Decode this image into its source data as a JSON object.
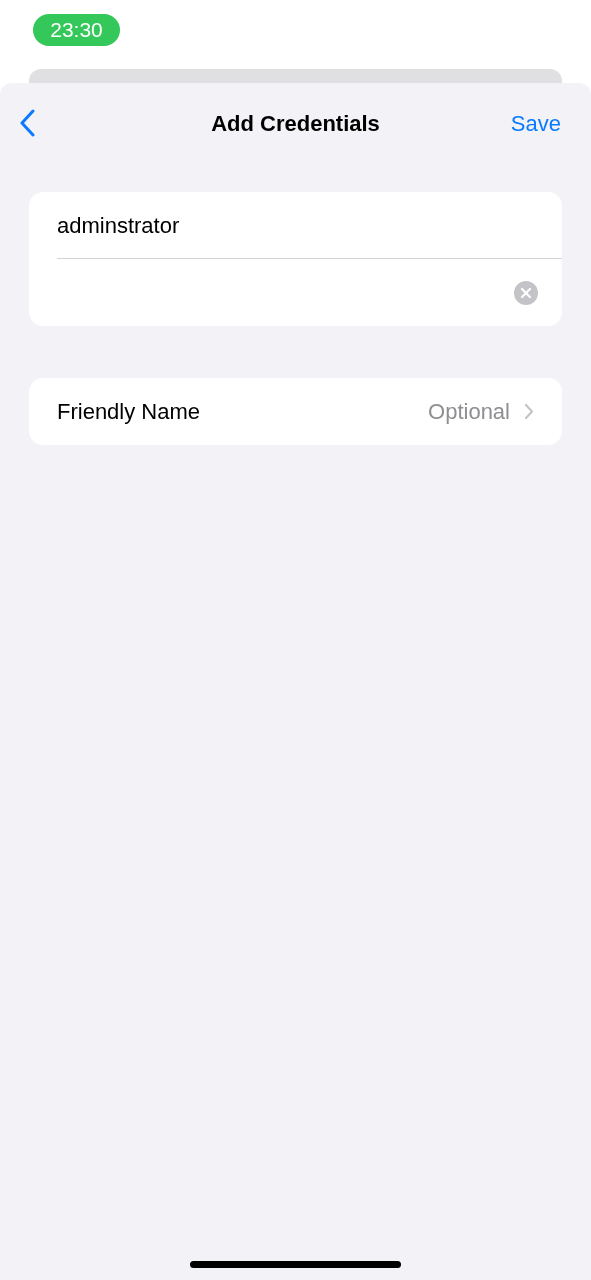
{
  "status_bar": {
    "time": "23:30"
  },
  "nav": {
    "title": "Add Credentials",
    "action": "Save"
  },
  "credentials": {
    "fields": [
      {
        "kind": "text",
        "value": "adminstrator",
        "clear_button": false
      },
      {
        "kind": "secure",
        "clear_button": true
      }
    ]
  },
  "rows": [
    {
      "label": "Friendly Name",
      "detail": "Optional"
    }
  ]
}
